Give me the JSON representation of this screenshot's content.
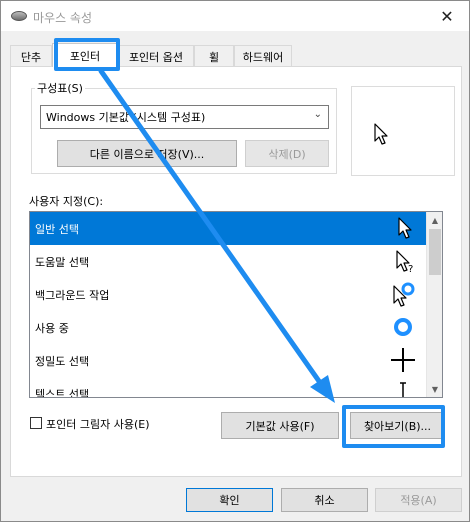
{
  "window": {
    "title": "마우스 속성",
    "close_glyph": "✕"
  },
  "tabs": [
    {
      "label": "단추"
    },
    {
      "label": "포인터"
    },
    {
      "label": "포인터 옵션"
    },
    {
      "label": "휠"
    },
    {
      "label": "하드웨어"
    }
  ],
  "scheme": {
    "group_label": "구성표(S)",
    "selected": "Windows 기본값 (시스템 구성표)",
    "save_as_label": "다른 이름으로 저장(V)...",
    "delete_label": "삭제(D)"
  },
  "customize": {
    "label": "사용자 지정(C):",
    "items": [
      {
        "label": "일반 선택",
        "icon": "arrow-cursor-icon"
      },
      {
        "label": "도움말 선택",
        "icon": "help-cursor-icon"
      },
      {
        "label": "백그라운드 작업",
        "icon": "busy-background-cursor-icon"
      },
      {
        "label": "사용 중",
        "icon": "busy-ring-icon"
      },
      {
        "label": "정밀도 선택",
        "icon": "crosshair-icon"
      },
      {
        "label": "텍스트 선택",
        "icon": "text-ibeam-icon"
      }
    ],
    "selected_index": 0
  },
  "shadow": {
    "label": "포인터 그림자 사용(E)",
    "checked": false
  },
  "buttons": {
    "use_default": "기본값 사용(F)",
    "browse": "찾아보기(B)...",
    "ok": "확인",
    "cancel": "취소",
    "apply": "적용(A)"
  },
  "colors": {
    "selection": "#0078d7",
    "highlight_annotation": "#1e8cf0",
    "busy_ring": "#1e90ff"
  }
}
